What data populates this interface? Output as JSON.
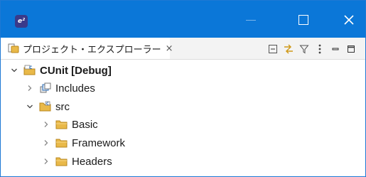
{
  "window": {
    "app_icon_text": "e²",
    "minimize_glyph": "—",
    "maximize_glyph": "☐",
    "close_glyph": "✕"
  },
  "tab": {
    "label": "プロジェクト・エクスプローラー",
    "close_glyph": "×"
  },
  "toolbar": {
    "items": [
      "collapse-all-icon",
      "link-with-editor-icon",
      "filter-icon",
      "view-menu-icon",
      "minimize-view-icon",
      "maximize-view-icon"
    ]
  },
  "tree": {
    "project": {
      "label": "CUnit [Debug]",
      "expanded": true
    },
    "includes": {
      "label": "Includes",
      "expanded": false
    },
    "src": {
      "label": "src",
      "expanded": true
    },
    "basic": {
      "label": "Basic",
      "expanded": false
    },
    "framework": {
      "label": "Framework",
      "expanded": false
    },
    "headers": {
      "label": "Headers",
      "expanded": false
    }
  },
  "colors": {
    "titlebar": "#0b77d8",
    "folder": "#e9b949",
    "accent_blue": "#2f6fb8"
  }
}
